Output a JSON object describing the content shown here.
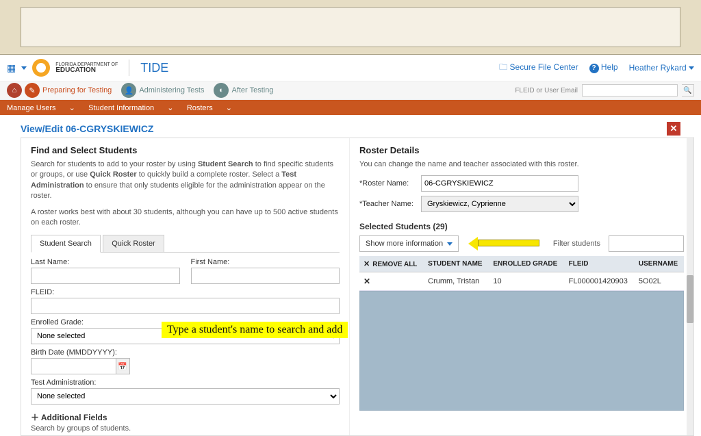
{
  "dept": {
    "line1": "FLORIDA DEPARTMENT OF",
    "line2": "EDUCATION"
  },
  "app_name": "TIDE",
  "topbar": {
    "secure": "Secure File Center",
    "help": "Help",
    "user": "Heather Rykard"
  },
  "nav": {
    "home_icon": "⌂",
    "items": [
      {
        "label": "Preparing for Testing",
        "active": true
      },
      {
        "label": "Administering Tests",
        "active": false
      },
      {
        "label": "After Testing",
        "active": false
      }
    ],
    "search_label": "FLEID or User Email"
  },
  "redband": [
    "Manage Users",
    "Student Information",
    "Rosters"
  ],
  "modal": {
    "title": "View/Edit 06-CGRYSKIEWICZ",
    "left": {
      "heading": "Find and Select Students",
      "p1a": "Search for students to add to your roster by using ",
      "p1b": "Student Search",
      "p1c": " to find specific students or groups, or use ",
      "p1d": "Quick Roster",
      "p1e": " to quickly build a complete roster. Select a ",
      "p1f": "Test Administration",
      "p1g": " to ensure that only students eligible for the administration appear on the roster.",
      "p2": "A roster works best with about 30 students, although you can have up to 500 active students on each roster.",
      "tabs": {
        "a": "Student Search",
        "b": "Quick Roster"
      },
      "labels": {
        "last": "Last Name:",
        "first": "First Name:",
        "fleid": "FLEID:",
        "grade": "Enrolled Grade:",
        "birth": "Birth Date (MMDDYYYY):",
        "test": "Test Administration:"
      },
      "none_selected": "None selected",
      "add_fields": "Additional Fields",
      "sub_note": "Search by groups of students."
    },
    "right": {
      "heading": "Roster Details",
      "sub": "You can change the name and teacher associated with this roster.",
      "roster_name_label": "*Roster Name:",
      "roster_name_value": "06-CGRYSKIEWICZ",
      "teacher_label": "*Teacher Name:",
      "teacher_value": "Gryskiewicz, Cyprienne",
      "selected_heading": "Selected Students (29)",
      "show_more": "Show more information",
      "filter_label": "Filter students",
      "table": {
        "remove_all": "REMOVE ALL",
        "cols": {
          "name": "STUDENT NAME",
          "grade": "ENROLLED GRADE",
          "fleid": "FLEID",
          "user": "USERNAME"
        },
        "rows": [
          {
            "name": "Crumm, Tristan",
            "grade": "10",
            "fleid": "FL000001420903",
            "user": "5O02L"
          }
        ]
      }
    },
    "callout": "Type a student's name to search and add"
  }
}
